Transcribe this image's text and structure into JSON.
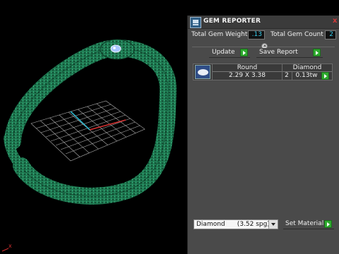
{
  "panel": {
    "title": "GEM REPORTER",
    "close_glyph": "x",
    "icon": "gem-reporter-app-icon",
    "total_weight_label": "Total Gem Weight",
    "total_weight_value": ".13",
    "total_count_label": "Total Gem Count",
    "total_count_value": "2",
    "update_label": "Update",
    "save_report_label": "Save Report"
  },
  "gem_table": {
    "headers": {
      "shape": "Round",
      "material": "Diamond"
    },
    "rows": [
      {
        "size": "2.29 X 3.38",
        "count": "2",
        "weight": "0.13tw",
        "thumbnail": "round-gem-icon"
      }
    ]
  },
  "material": {
    "selected": "Diamond      (3.52 spg)",
    "set_label": "Set Material"
  },
  "viewport": {
    "axis_label": "x",
    "colors": {
      "snake": "#1e8a5c",
      "grid": "#cfcfcf",
      "axis_x": "#d23030",
      "axis_y": "#2fb3c8",
      "eye": "#a9c6ff"
    }
  }
}
